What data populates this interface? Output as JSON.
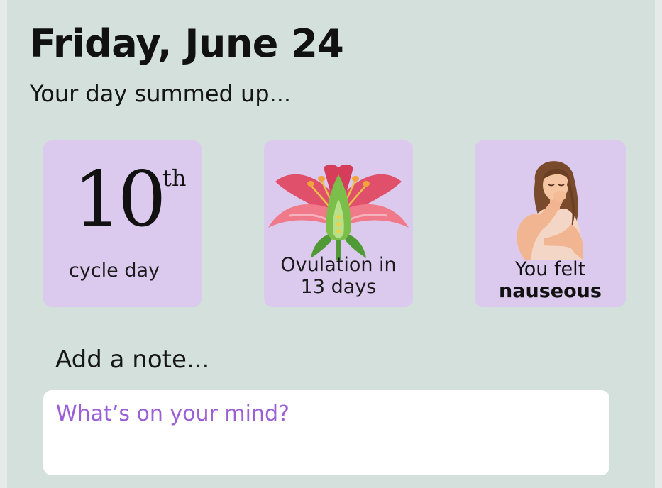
{
  "header": {
    "title": "Friday, June 24",
    "subtitle": "Your day summed up..."
  },
  "cards": {
    "cycle": {
      "number": "10",
      "ordinal": "th",
      "label": "cycle day",
      "icon": "none"
    },
    "ovulation": {
      "line1": "Ovulation in",
      "line2": "13 days",
      "icon": "lily-flower-icon"
    },
    "mood": {
      "line1": "You felt",
      "emphasis": "nauseous",
      "icon": "nauseous-woman-icon"
    }
  },
  "note": {
    "heading": "Add a note...",
    "placeholder": "What’s on your mind?",
    "value": ""
  },
  "colors": {
    "background": "#d3e0dc",
    "card": "#dbc9ee",
    "placeholder": "#9b5fd6",
    "input_bg": "#ffffff"
  }
}
